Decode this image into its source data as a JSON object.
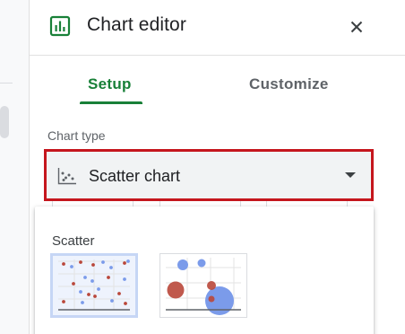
{
  "panel": {
    "title": "Chart editor",
    "icons": {
      "chart": "bar-chart-icon",
      "close": "close-icon"
    }
  },
  "tabs": [
    {
      "label": "Setup",
      "active": true
    },
    {
      "label": "Customize",
      "active": false
    }
  ],
  "chart_type": {
    "label": "Chart type",
    "selected": "Scatter chart",
    "highlight_color": "#c5161d"
  },
  "menu": {
    "section_label": "Scatter",
    "options": [
      {
        "name": "scatter",
        "icon": "scatter-chart-thumbnail",
        "selected": true
      },
      {
        "name": "bubble",
        "icon": "bubble-chart-thumbnail",
        "selected": false
      }
    ]
  },
  "colors": {
    "accent_green": "#188038",
    "series_blue": "#7b9bea",
    "series_red": "#b9473a"
  }
}
